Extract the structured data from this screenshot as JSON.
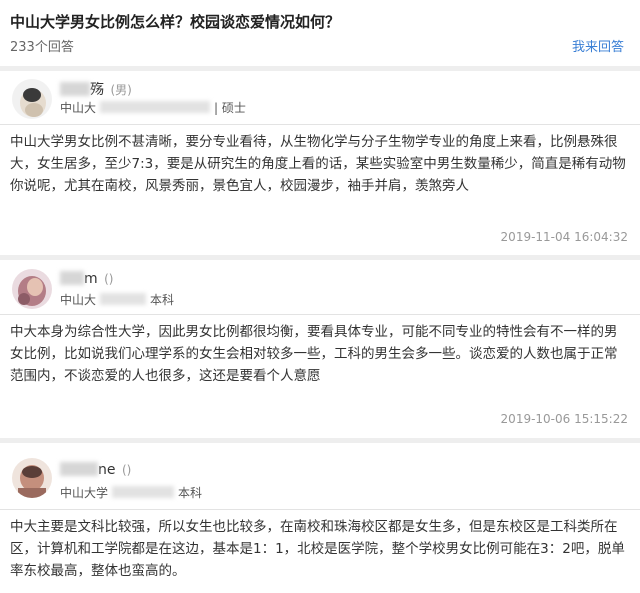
{
  "question": {
    "title": "中山大学男女比例怎么样？校园谈恋爱情况如何？",
    "answer_count": "233个回答",
    "answer_link": "我来回答"
  },
  "answers": [
    {
      "name_suffix": "殇",
      "name_tag": "(男)",
      "school": "中山大",
      "degree": "| 硕士",
      "text": "中山大学男女比例不甚清晰，要分专业看待，从生物化学与分子生物学专业的角度上来看，比例悬殊很大，女生居多，至少7:3，要是从研究生的角度上看的话，某些实验室中男生数量稀少，简直是稀有动物你说呢，尤其在南校，风景秀丽，景色宜人，校园漫步，袖手并肩，羡煞旁人",
      "time": "2019-11-04 16:04:32"
    },
    {
      "name_suffix": "m",
      "name_tag": "()",
      "school": "中山大",
      "degree": "本科",
      "text": "中大本身为综合性大学，因此男女比例都很均衡，要看具体专业，可能不同专业的特性会有不一样的男女比例，比如说我们心理学系的女生会相对较多一些，工科的男生会多一些。谈恋爱的人数也属于正常范围内，不谈恋爱的人也很多，这还是要看个人意愿",
      "time": "2019-10-06 15:15:22"
    },
    {
      "name_suffix": "ne",
      "name_tag": "()",
      "school": "中山大学",
      "degree": "本科",
      "text": "中大主要是文科比较强，所以女生也比较多，在南校和珠海校区都是女生多，但是东校区是工科类所在区，计算机和工学院都是在这边，基本是1：1，北校是医学院，整个学校男女比例可能在3：2吧，脱单率东校最高，整体也蛮高的。"
    }
  ],
  "colors": {
    "link": "#3a7fd5",
    "background": "#eeeeee"
  }
}
